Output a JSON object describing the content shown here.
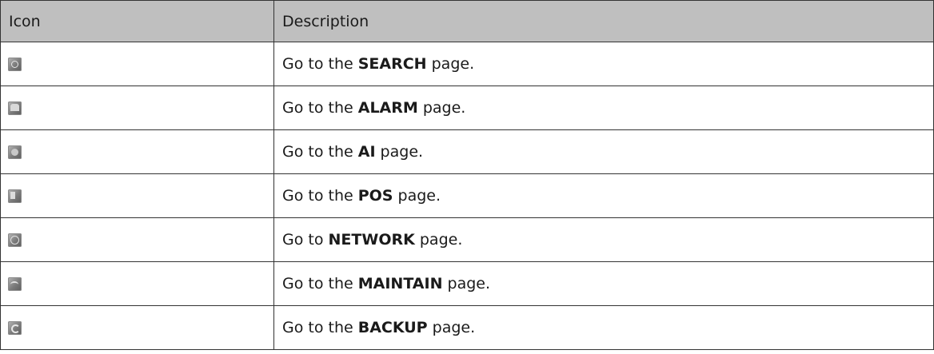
{
  "table": {
    "headers": {
      "icon": "Icon",
      "description": "Description"
    },
    "rows": [
      {
        "icon": "search-icon",
        "prefix": "Go to the ",
        "keyword": "SEARCH",
        "suffix": " page."
      },
      {
        "icon": "alarm-icon",
        "prefix": "Go to the ",
        "keyword": "ALARM",
        "suffix": " page."
      },
      {
        "icon": "ai-icon",
        "prefix": "Go to the ",
        "keyword": "AI",
        "suffix": " page."
      },
      {
        "icon": "pos-icon",
        "prefix": "Go to the ",
        "keyword": "POS",
        "suffix": " page."
      },
      {
        "icon": "network-icon",
        "prefix": "Go to ",
        "keyword": "NETWORK",
        "suffix": " page."
      },
      {
        "icon": "maintain-icon",
        "prefix": "Go to the ",
        "keyword": "MAINTAIN",
        "suffix": " page."
      },
      {
        "icon": "backup-icon",
        "prefix": "Go to the ",
        "keyword": "BACKUP",
        "suffix": " page."
      }
    ]
  }
}
